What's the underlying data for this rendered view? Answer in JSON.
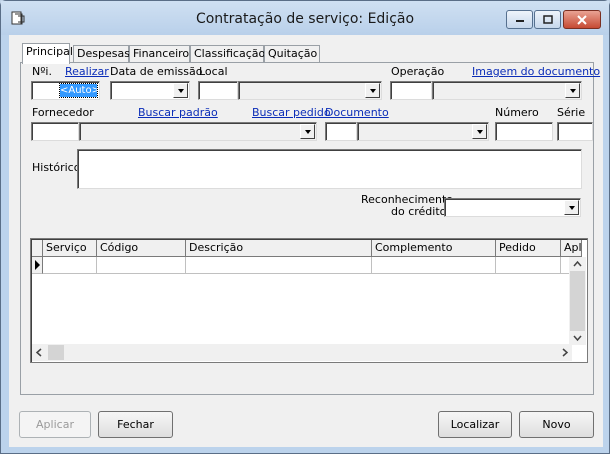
{
  "window": {
    "title": "Contratação de serviço: Edição",
    "buttons": {
      "minimize": "minimize",
      "maximize": "maximize",
      "close": "close"
    }
  },
  "tabs": [
    "Principal",
    "Despesas",
    "Financeiro",
    "Classificação",
    "Quitação"
  ],
  "active_tab": "Principal",
  "form": {
    "numero_label": "Nºi.",
    "realizar_link": "Realizar",
    "numero_value": "<Auto>",
    "data_emissao_label": "Data de emissão",
    "local_label": "Local",
    "operacao_label": "Operação",
    "imagem_link": "Imagem do documento",
    "fornecedor_label": "Fornecedor",
    "buscar_padrao_link": "Buscar padrão",
    "buscar_pedido_link": "Buscar pedido",
    "documento_link": "Documento",
    "numero_doc_label": "Número",
    "serie_label": "Série",
    "historico_label": "Histórico:",
    "reconhecimento_label_1": "Reconhecimento",
    "reconhecimento_label_2": "do crédito:"
  },
  "grid": {
    "columns": [
      "Serviço",
      "Código",
      "Descrição",
      "Complemento",
      "Pedido",
      "Apl"
    ]
  },
  "footer": {
    "aplicar": "Aplicar",
    "fechar": "Fechar",
    "localizar": "Localizar",
    "novo": "Novo"
  }
}
